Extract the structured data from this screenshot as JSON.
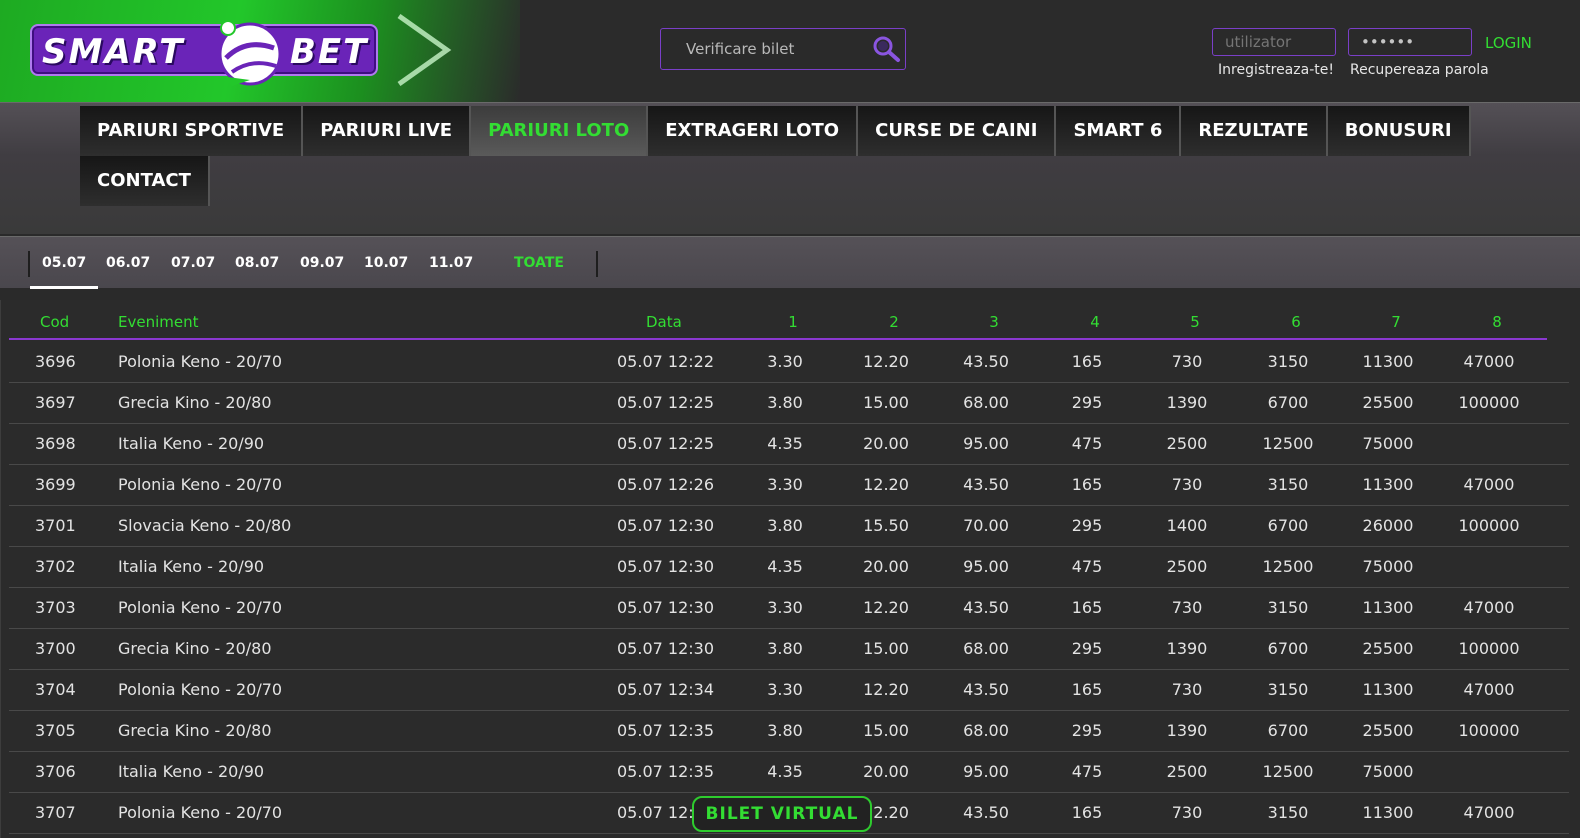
{
  "brand": {
    "left": "SMART",
    "right": "BET",
    "accent": "#22c72a",
    "purple": "#6a24b8"
  },
  "search": {
    "placeholder": "Verificare bilet"
  },
  "login": {
    "username_placeholder": "utilizator",
    "password_value": "••••••",
    "login_label": "LOGIN",
    "register_label": "Inregistreaza-te!",
    "recover_label": "Recupereaza parola"
  },
  "nav": {
    "items": [
      {
        "label": "PARIURI SPORTIVE",
        "active": false
      },
      {
        "label": "PARIURI LIVE",
        "active": false
      },
      {
        "label": "PARIURI LOTO",
        "active": true
      },
      {
        "label": "EXTRAGERI LOTO",
        "active": false
      },
      {
        "label": "CURSE DE CAINI",
        "active": false
      },
      {
        "label": "SMART 6",
        "active": false
      },
      {
        "label": "REZULTATE",
        "active": false
      },
      {
        "label": "BONUSURI",
        "active": false
      },
      {
        "label": "CONTACT",
        "active": false
      }
    ]
  },
  "dates": {
    "tabs": [
      "05.07",
      "06.07",
      "07.07",
      "08.07",
      "09.07",
      "10.07",
      "11.07"
    ],
    "selected": "05.07",
    "all_label": "TOATE"
  },
  "table": {
    "headers": {
      "cod": "Cod",
      "eveniment": "Eveniment",
      "data": "Data",
      "cols": [
        "1",
        "2",
        "3",
        "4",
        "5",
        "6",
        "7",
        "8"
      ]
    },
    "rows": [
      {
        "cod": "3696",
        "ev": "Polonia Keno - 20/70",
        "data": "05.07 12:22",
        "odds": [
          "3.30",
          "12.20",
          "43.50",
          "165",
          "730",
          "3150",
          "11300",
          "47000"
        ]
      },
      {
        "cod": "3697",
        "ev": "Grecia Kino - 20/80",
        "data": "05.07 12:25",
        "odds": [
          "3.80",
          "15.00",
          "68.00",
          "295",
          "1390",
          "6700",
          "25500",
          "100000"
        ]
      },
      {
        "cod": "3698",
        "ev": "Italia Keno - 20/90",
        "data": "05.07 12:25",
        "odds": [
          "4.35",
          "20.00",
          "95.00",
          "475",
          "2500",
          "12500",
          "75000",
          ""
        ]
      },
      {
        "cod": "3699",
        "ev": "Polonia Keno - 20/70",
        "data": "05.07 12:26",
        "odds": [
          "3.30",
          "12.20",
          "43.50",
          "165",
          "730",
          "3150",
          "11300",
          "47000"
        ]
      },
      {
        "cod": "3701",
        "ev": "Slovacia Keno - 20/80",
        "data": "05.07 12:30",
        "odds": [
          "3.80",
          "15.50",
          "70.00",
          "295",
          "1400",
          "6700",
          "26000",
          "100000"
        ]
      },
      {
        "cod": "3702",
        "ev": "Italia Keno - 20/90",
        "data": "05.07 12:30",
        "odds": [
          "4.35",
          "20.00",
          "95.00",
          "475",
          "2500",
          "12500",
          "75000",
          ""
        ]
      },
      {
        "cod": "3703",
        "ev": "Polonia Keno - 20/70",
        "data": "05.07 12:30",
        "odds": [
          "3.30",
          "12.20",
          "43.50",
          "165",
          "730",
          "3150",
          "11300",
          "47000"
        ]
      },
      {
        "cod": "3700",
        "ev": "Grecia Kino - 20/80",
        "data": "05.07 12:30",
        "odds": [
          "3.80",
          "15.00",
          "68.00",
          "295",
          "1390",
          "6700",
          "25500",
          "100000"
        ]
      },
      {
        "cod": "3704",
        "ev": "Polonia Keno - 20/70",
        "data": "05.07 12:34",
        "odds": [
          "3.30",
          "12.20",
          "43.50",
          "165",
          "730",
          "3150",
          "11300",
          "47000"
        ]
      },
      {
        "cod": "3705",
        "ev": "Grecia Kino - 20/80",
        "data": "05.07 12:35",
        "odds": [
          "3.80",
          "15.00",
          "68.00",
          "295",
          "1390",
          "6700",
          "25500",
          "100000"
        ]
      },
      {
        "cod": "3706",
        "ev": "Italia Keno - 20/90",
        "data": "05.07 12:35",
        "odds": [
          "4.35",
          "20.00",
          "95.00",
          "475",
          "2500",
          "12500",
          "75000",
          ""
        ]
      },
      {
        "cod": "3707",
        "ev": "Polonia Keno - 20/70",
        "data": "05.07 12:",
        "odds": [
          "",
          "12.20",
          "43.50",
          "165",
          "730",
          "3150",
          "11300",
          "47000"
        ]
      }
    ]
  },
  "virtual_ticket": {
    "label": "BILET VIRTUAL"
  }
}
